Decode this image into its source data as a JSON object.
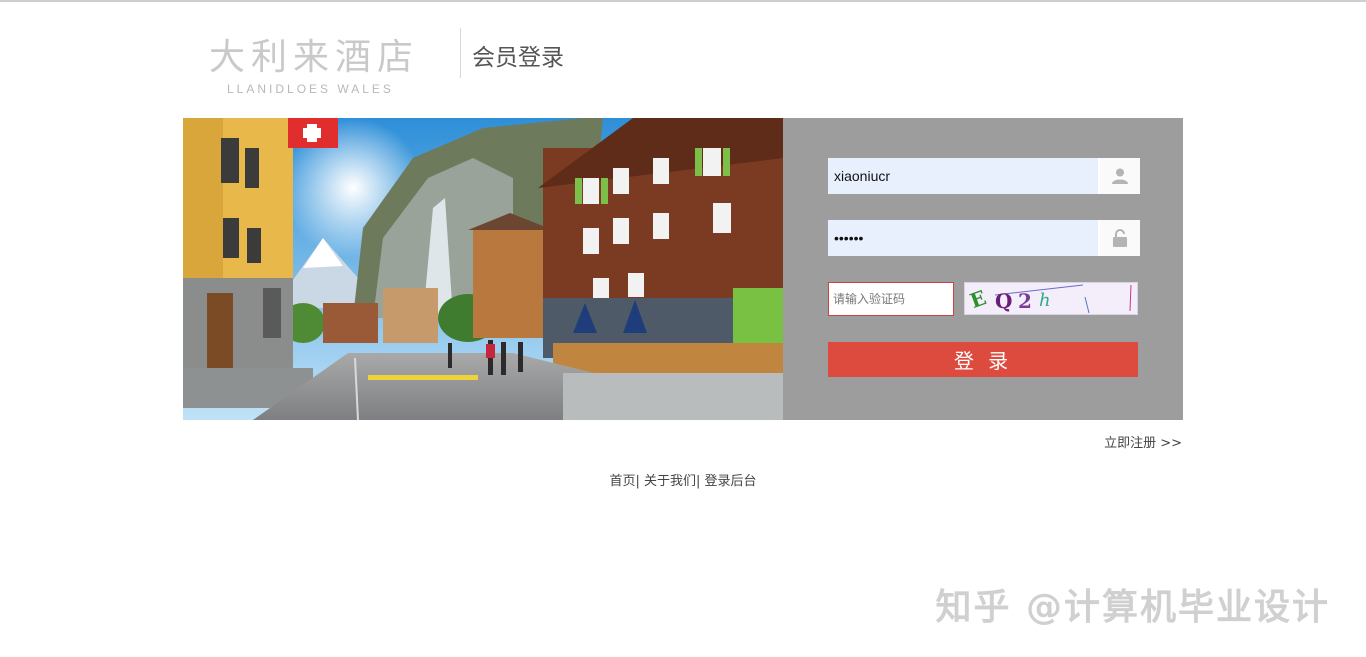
{
  "header": {
    "logo_cn": "大利来酒店",
    "logo_en": "LLANIDLOES WALES",
    "title": "会员登录"
  },
  "banner": {
    "icon": "alpine-village-photo"
  },
  "login": {
    "username_value": "xiaoniucr",
    "password_value": "xiaoni",
    "captcha_placeholder": "请输入验证码",
    "captcha_text": "E Q 2 h",
    "submit_label": "登 录",
    "username_icon": "user-icon",
    "password_icon": "lock-icon"
  },
  "register_label": "立即注册 >>",
  "footer": {
    "link_home": "首页",
    "link_about": "关于我们",
    "link_admin": "登录后台",
    "sep": "|"
  },
  "watermark": "知乎 @计算机毕业设计",
  "colors": {
    "panel_bg": "#9c9d9c",
    "button_bg": "#dd4b3f",
    "input_bg": "#e8f0fe"
  }
}
